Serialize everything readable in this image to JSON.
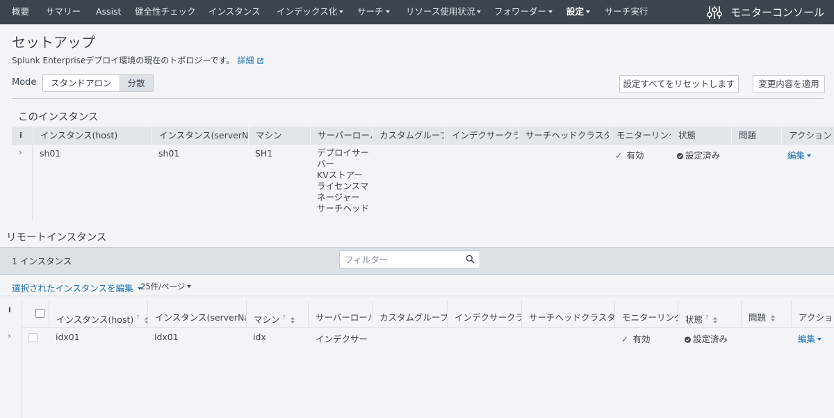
{
  "topnav": {
    "items": [
      {
        "label": "概要"
      },
      {
        "label": "サマリー"
      },
      {
        "label": "Assist"
      },
      {
        "label": "健全性チェック"
      },
      {
        "label": "インスタンス"
      },
      {
        "label": "インデックス化"
      },
      {
        "label": "サーチ"
      },
      {
        "label": "リソース使用状況"
      },
      {
        "label": "フォワーダー"
      },
      {
        "label": "設定"
      },
      {
        "label": "サーチ実行"
      }
    ],
    "app_name": "モニターコンソール"
  },
  "header": {
    "title": "セットアップ",
    "subtitle": "Splunk Enterpriseデプロイ環境の現在のトポロジーです。",
    "more_link": "詳細"
  },
  "mode": {
    "label": "Mode",
    "options": [
      "スタンドアロン",
      "分散"
    ],
    "selected": "分散"
  },
  "actions": {
    "reset": "設定すべてをリセットします",
    "apply": "変更内容を適用"
  },
  "this_instance": {
    "title": "このインスタンス",
    "columns": [
      "i",
      "インスタンス(host)",
      "インスタンス(serverName)",
      "マシン",
      "サーバーロール",
      "カスタムグループ",
      "インデクサークラスター",
      "サーチヘッドクラスター",
      "モニターリング",
      "状態",
      "問題",
      "アクション"
    ],
    "row": {
      "host": "sh01",
      "serverName": "sh01",
      "machine": "SH1",
      "roles": [
        "デプロイサー",
        "バー",
        "KVストアー",
        "ライセンスマ",
        "ネージャー",
        "サーチヘッド"
      ],
      "monitoring": "有効",
      "state": "設定済み",
      "action": "編集"
    }
  },
  "remote": {
    "title": "リモートインスタンス",
    "count": "1 インスタンス",
    "filter_placeholder": "フィルター",
    "bulk_edit": "選択されたインスタンスを編集",
    "per_page": "25件/ページ",
    "columns": [
      "i",
      "",
      "インスタンス(host)",
      "インスタンス(serverName)",
      "マシン",
      "サーバーロール",
      "カスタムグループ",
      "インデクサークラスター",
      "サーチヘッドクラスター",
      "モニターリング",
      "状態",
      "問題",
      "アクション"
    ],
    "row": {
      "host": "idx01",
      "serverName": "idx01",
      "machine": "idx",
      "roles": "インデクサー",
      "monitoring": "有効",
      "state": "設定済み",
      "action": "編集"
    }
  },
  "colors": {
    "nav_bg": "#3c444d",
    "link": "#1a6fb5",
    "header_bg": "#e1e6eb",
    "page_bg": "#f2f4f5"
  }
}
